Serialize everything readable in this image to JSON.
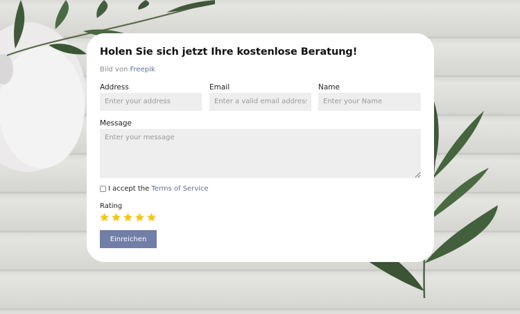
{
  "form": {
    "title": "Holen Sie sich jetzt Ihre kostenlose Beratung!",
    "credit_prefix": "Bild von",
    "credit_link": "Freepik",
    "fields": {
      "address": {
        "label": "Address",
        "placeholder": "Enter your address"
      },
      "email": {
        "label": "Email",
        "placeholder": "Enter a valid email address"
      },
      "name": {
        "label": "Name",
        "placeholder": "Enter your Name"
      },
      "message": {
        "label": "Message",
        "placeholder": "Enter your message"
      }
    },
    "accept_text": "I accept the",
    "terms_link": "Terms of Service",
    "rating": {
      "label": "Rating",
      "value": 5,
      "max": 5,
      "star_color": "#f5c518"
    },
    "submit_label": "Einreichen"
  },
  "colors": {
    "accent": "#717ea8",
    "link": "#5f6f99"
  },
  "icons": [
    "star-icon",
    "leaf-branch",
    "vase"
  ]
}
